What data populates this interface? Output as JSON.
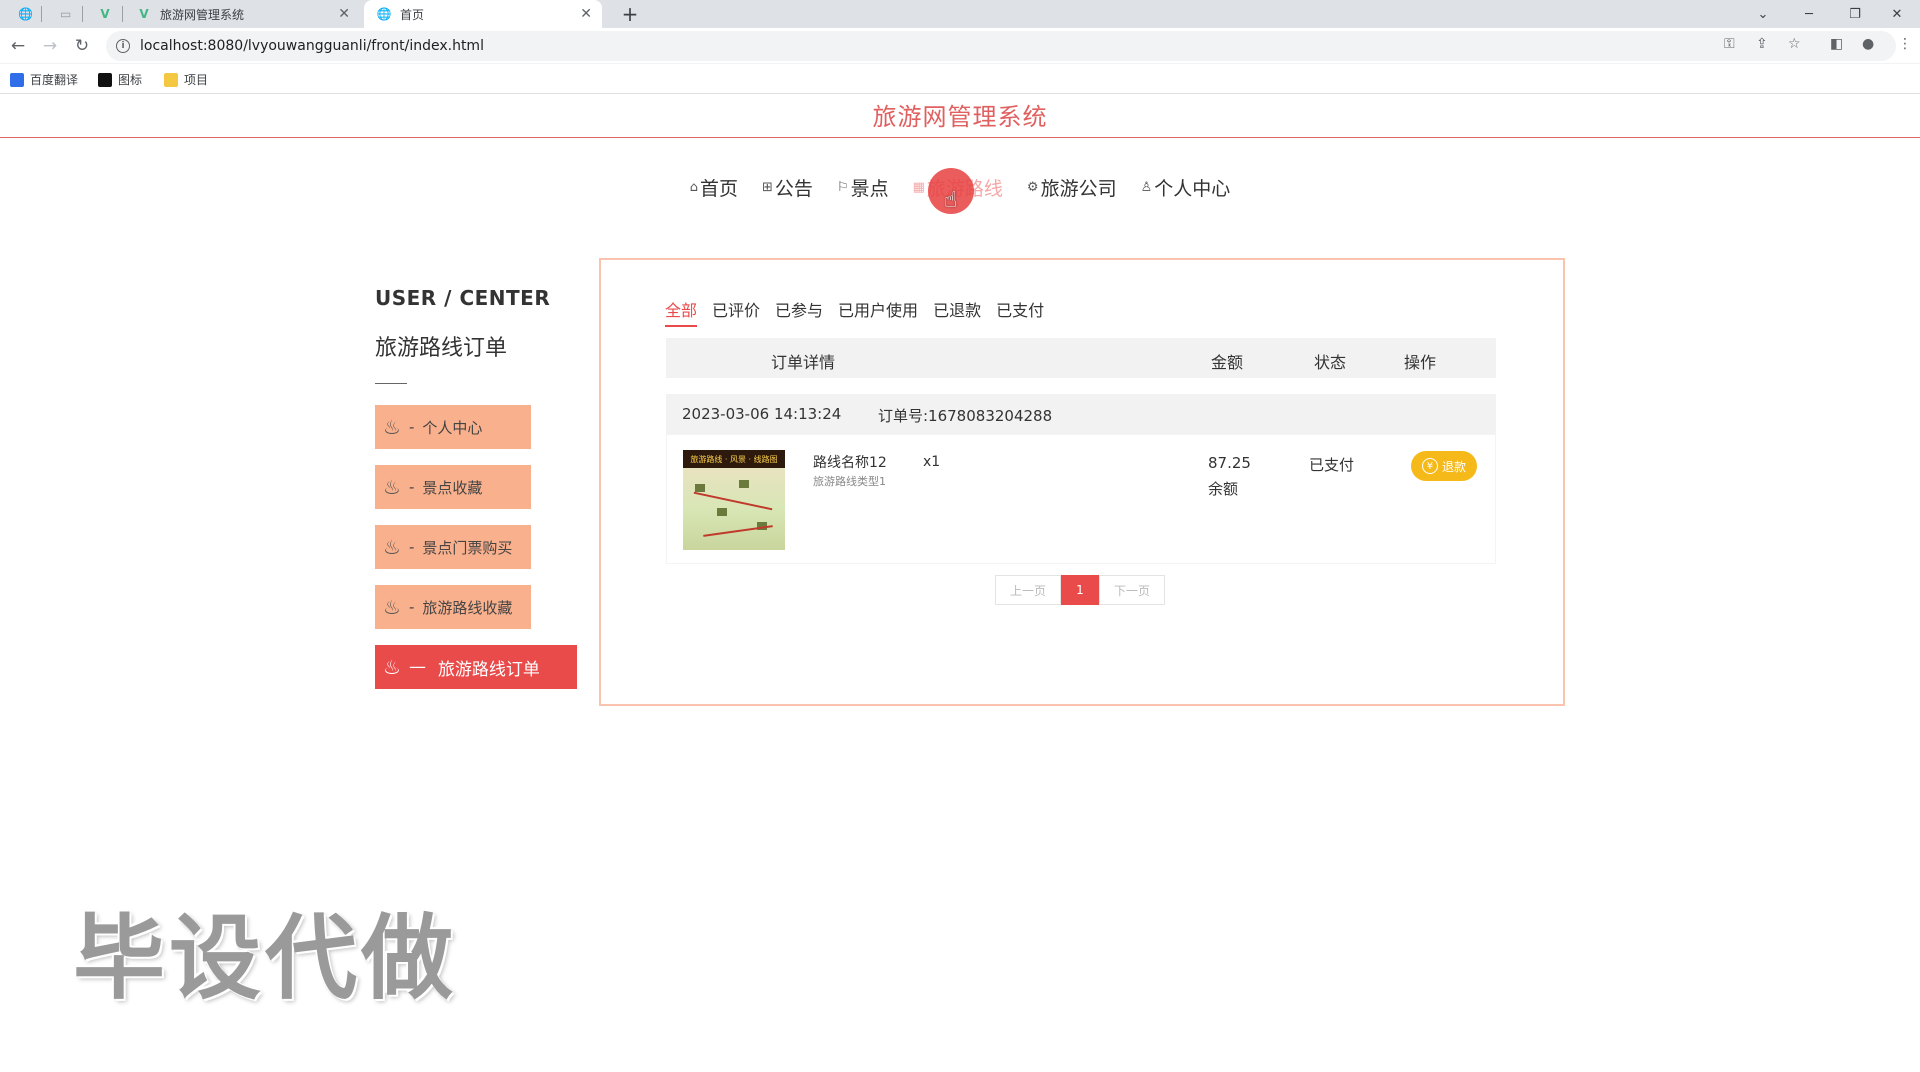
{
  "browser": {
    "tabs": [
      {
        "title": ""
      },
      {
        "title": ""
      },
      {
        "title": ""
      },
      {
        "title": "旅游网管理系统"
      },
      {
        "title": "首页"
      }
    ],
    "url": "localhost:8080/lvyouwangguanli/front/index.html",
    "bookmarks": [
      {
        "label": "百度翻译",
        "color": "#2f6ee8"
      },
      {
        "label": "图标",
        "color": "#111111"
      },
      {
        "label": "项目",
        "color": "#f4c842"
      }
    ]
  },
  "site": {
    "title": "旅游网管理系统",
    "nav": [
      {
        "label": "首页",
        "icon": "home-icon"
      },
      {
        "label": "公告",
        "icon": "grid-icon"
      },
      {
        "label": "景点",
        "icon": "flag-icon"
      },
      {
        "label": "旅游路线",
        "icon": "route-icon",
        "active": true
      },
      {
        "label": "旅游公司",
        "icon": "gear-icon"
      },
      {
        "label": "个人中心",
        "icon": "user-icon"
      }
    ]
  },
  "sidebar": {
    "title": "USER / CENTER",
    "subtitle": "旅游路线订单",
    "items": [
      {
        "label": "个人中心",
        "prefix": "-"
      },
      {
        "label": "景点收藏",
        "prefix": "-"
      },
      {
        "label": "景点门票购买",
        "prefix": "-"
      },
      {
        "label": "旅游路线收藏",
        "prefix": "-"
      },
      {
        "label": "旅游路线订单",
        "prefix": "—",
        "active": true
      }
    ]
  },
  "orders": {
    "status_tabs": [
      "全部",
      "已评价",
      "已参与",
      "已用户使用",
      "已退款",
      "已支付"
    ],
    "active_tab": "全部",
    "columns": {
      "detail": "订单详情",
      "amount": "金额",
      "status": "状态",
      "action": "操作"
    },
    "items": [
      {
        "time": "2023-03-06 14:13:24",
        "order_no": "订单号:1678083204288",
        "product_name": "路线名称12",
        "product_type": "旅游路线类型1",
        "quantity": "x1",
        "amount": "87.25",
        "pay_method": "余额",
        "status": "已支付",
        "action": "退款",
        "thumb_banner": "旅游路线 · 风景 · 线路图"
      }
    ],
    "pager": {
      "prev": "上一页",
      "current": "1",
      "next": "下一页"
    }
  },
  "watermark": "毕设代做",
  "colors": {
    "accent": "#e94b4b",
    "sidebar": "#f9b08d",
    "refund": "#f6b91a"
  }
}
